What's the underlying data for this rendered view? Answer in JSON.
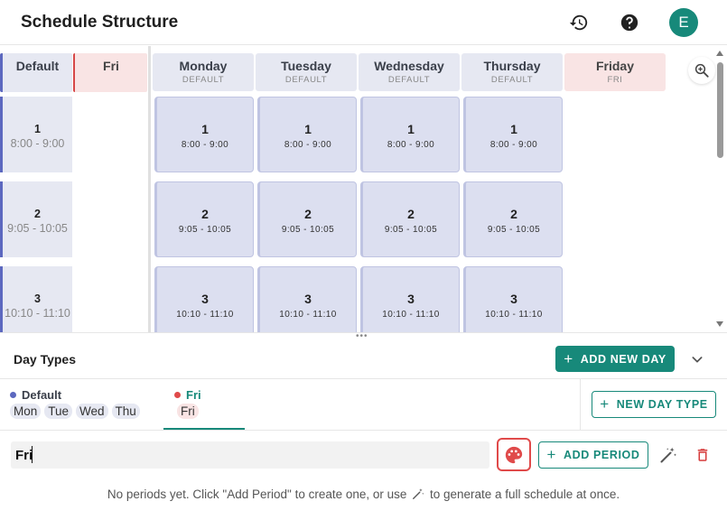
{
  "header": {
    "title": "Schedule Structure",
    "history_icon": "history-icon",
    "help_icon": "help-icon",
    "avatar_letter": "E",
    "accent": "#17897a"
  },
  "grid": {
    "sidebar_headers": {
      "default": "Default",
      "fri": "Fri"
    },
    "columns": [
      {
        "name": "Monday",
        "type": "DEFAULT"
      },
      {
        "name": "Tuesday",
        "type": "DEFAULT"
      },
      {
        "name": "Wednesday",
        "type": "DEFAULT"
      },
      {
        "name": "Thursday",
        "type": "DEFAULT"
      },
      {
        "name": "Friday",
        "type": "FRI"
      }
    ],
    "periods": [
      {
        "num": "1",
        "time": "8:00 - 9:00"
      },
      {
        "num": "2",
        "time": "9:05 - 10:05"
      },
      {
        "num": "3",
        "time": "10:10 - 11:10"
      }
    ],
    "zoom_icon": "zoom-in-icon"
  },
  "day_types": {
    "title": "Day Types",
    "add_new_day": "ADD NEW DAY",
    "collapse_icon": "chevron-down-icon",
    "tabs": [
      {
        "name": "Default",
        "color": "#5c68bf",
        "days": [
          "Mon",
          "Tue",
          "Wed",
          "Thu"
        ]
      },
      {
        "name": "Fri",
        "color": "#e04a4a",
        "days": [
          "Fri"
        ]
      }
    ],
    "new_day_type": "NEW DAY TYPE"
  },
  "editor": {
    "name_value": "Fri",
    "palette_icon": "palette-icon",
    "add_period": "ADD PERIOD",
    "wand_icon": "magic-wand-icon",
    "delete_icon": "trash-icon",
    "hint_before": "No periods yet. Click \"Add Period\" to create one, or use",
    "hint_after": "to generate a full schedule at once."
  }
}
